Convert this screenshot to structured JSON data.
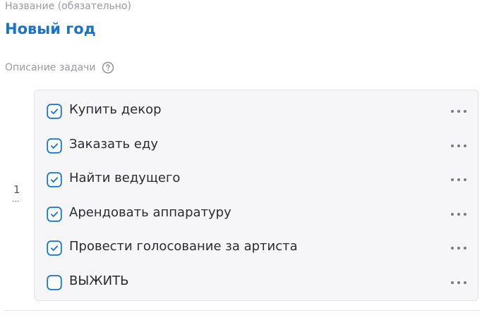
{
  "form": {
    "title_label": "Название (обязательно)",
    "title_value": "Новый год",
    "description_label": "Описание задачи"
  },
  "gutter": {
    "line_number": "1",
    "dots": "..."
  },
  "checklist": {
    "accent_color": "#1a73c8",
    "items": [
      {
        "label": "Купить декор",
        "checked": true
      },
      {
        "label": "Заказать еду",
        "checked": true
      },
      {
        "label": "Найти ведущего",
        "checked": true
      },
      {
        "label": "Арендовать аппаратуру",
        "checked": true
      },
      {
        "label": "Провести голосование за артиста",
        "checked": true
      },
      {
        "label": "ВЫЖИТЬ",
        "checked": false
      }
    ]
  },
  "icons": {
    "help": "question-circle-icon",
    "checkbox_checked": "checkbox-checked-icon",
    "checkbox_unchecked": "checkbox-unchecked-icon",
    "more": "more-horizontal-icon"
  }
}
